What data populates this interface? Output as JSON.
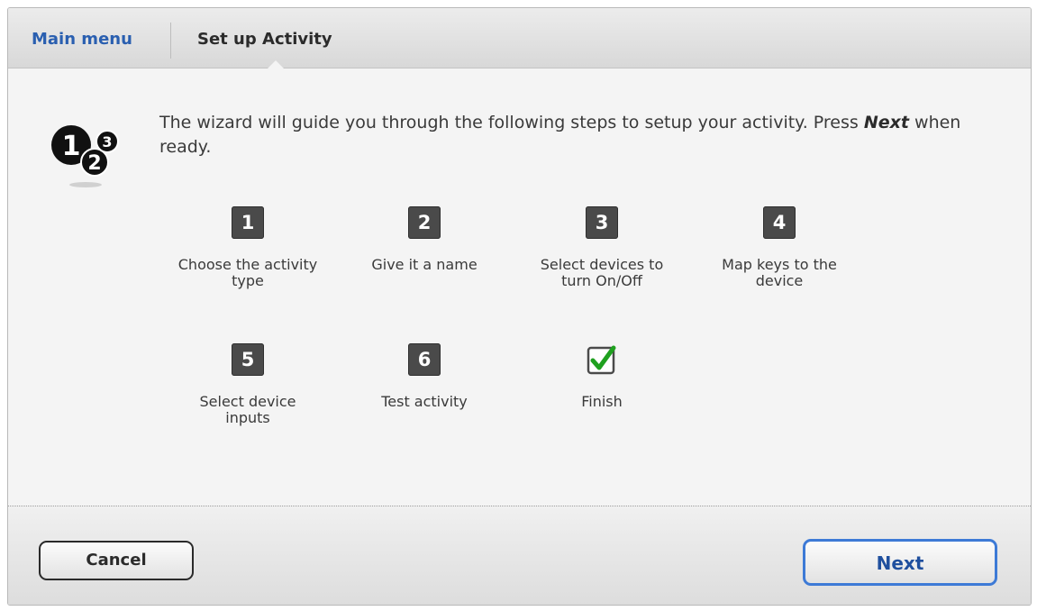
{
  "header": {
    "main_menu": "Main menu",
    "current": "Set up Activity"
  },
  "wizard": {
    "icon": "steps-123-icon",
    "intro_before": "The wizard will guide you through the following steps to setup your activity. Press ",
    "intro_emph": "Next",
    "intro_after": " when ready."
  },
  "steps": [
    {
      "number": "1",
      "label_line1": "Choose the activity",
      "label_line2": "type"
    },
    {
      "number": "2",
      "label_line1": "Give it a name",
      "label_line2": ""
    },
    {
      "number": "3",
      "label_line1": "Select devices to",
      "label_line2": "turn On/Off"
    },
    {
      "number": "4",
      "label_line1": "Map keys to the",
      "label_line2": "device"
    },
    {
      "number": "5",
      "label_line1": "Select device",
      "label_line2": "inputs"
    },
    {
      "number": "6",
      "label_line1": "Test activity",
      "label_line2": ""
    },
    {
      "icon": "green-checkmark-icon",
      "label_line1": "Finish",
      "label_line2": ""
    }
  ],
  "footer": {
    "cancel": "Cancel",
    "next": "Next"
  },
  "colors": {
    "link": "#2a5fb0",
    "badge": "#4a4a4a",
    "check": "#1fa01f",
    "next_border": "#3d7ad6"
  }
}
